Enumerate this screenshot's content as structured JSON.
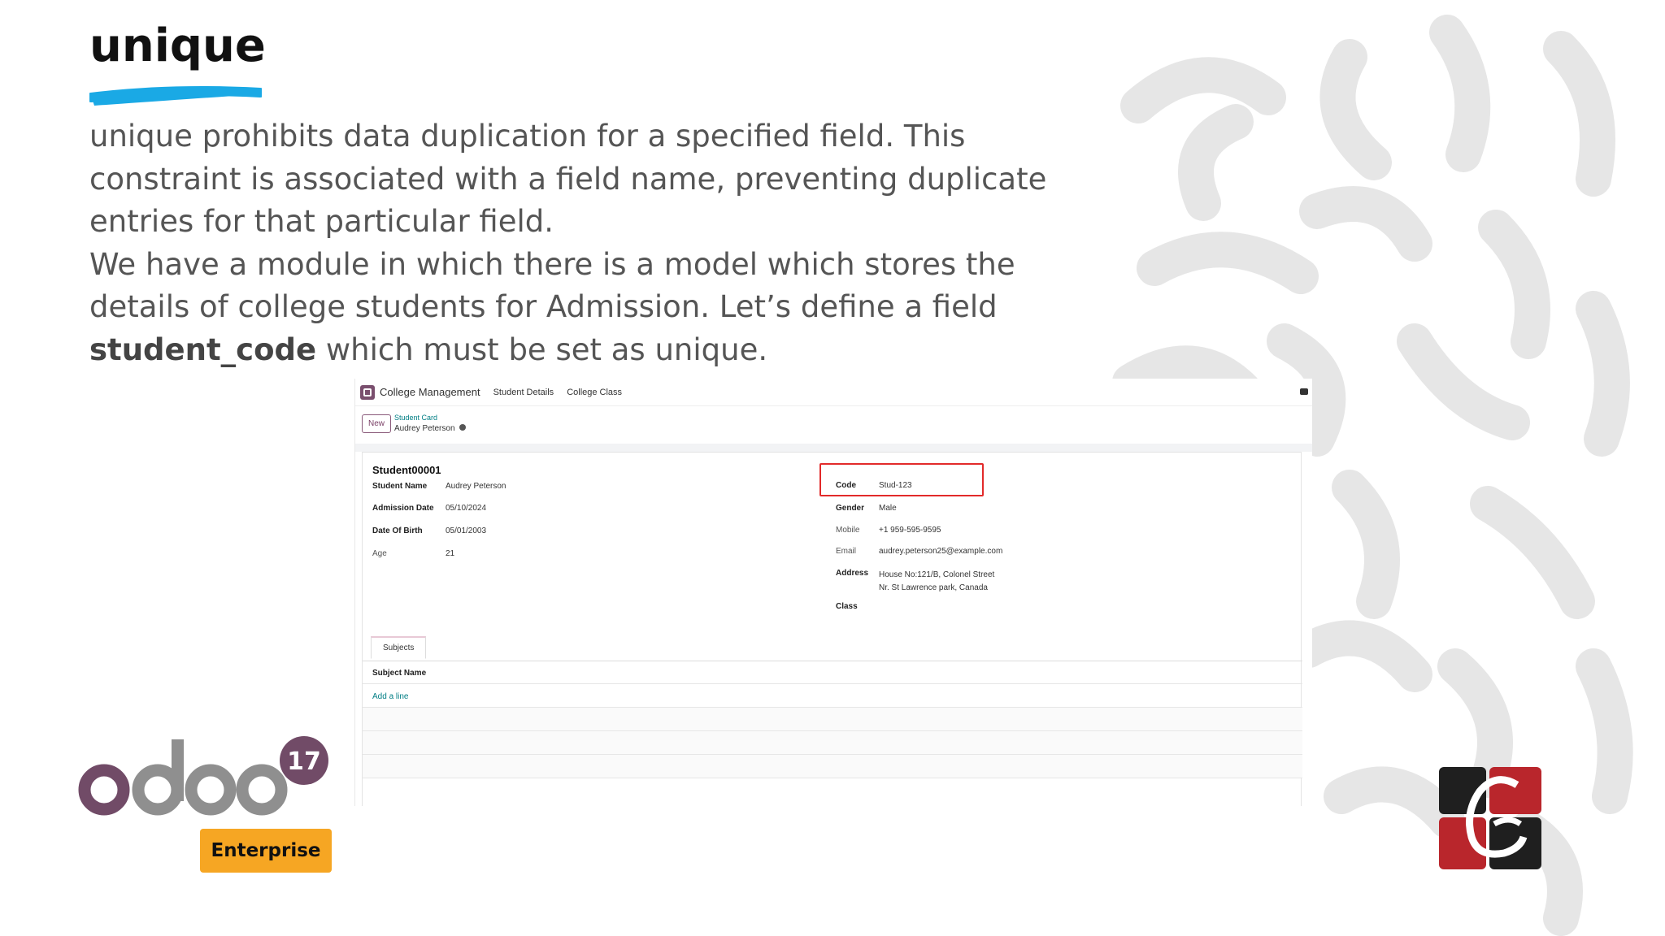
{
  "slide": {
    "title": "unique",
    "paragraph1": "unique prohibits data duplication for a specified field. This constraint is associated with a field name, preventing duplicate entries for that particular field.",
    "paragraph2_before": "We have a module in which there is a model which stores the details of college students for Admission. Let’s define a field ",
    "paragraph2_bold": "student_code",
    "paragraph2_after": " which must be set as unique."
  },
  "odoo": {
    "app_name": "College Management",
    "menu": [
      "Student Details",
      "College Class"
    ],
    "new_button": "New",
    "breadcrumb_parent": "Student Card",
    "breadcrumb_current": "Audrey Peterson",
    "record_title": "Student00001",
    "left_fields": [
      {
        "label": "Student Name",
        "value": "Audrey Peterson"
      },
      {
        "label": "Admission Date",
        "value": "05/10/2024"
      },
      {
        "label": "Date Of Birth",
        "value": "05/01/2003"
      },
      {
        "label": "Age",
        "value": "21"
      }
    ],
    "right_fields": [
      {
        "label": "Code",
        "value": "Stud-123"
      },
      {
        "label": "Gender",
        "value": "Male"
      },
      {
        "label": "Mobile",
        "value": "+1 959-595-9595"
      },
      {
        "label": "Email",
        "value": "audrey.peterson25@example.com"
      },
      {
        "label": "Address",
        "value_line1": "House No:121/B, Colonel Street",
        "value_line2": "Nr. St Lawrence park, Canada"
      },
      {
        "label": "Class",
        "value": ""
      }
    ],
    "tab_label": "Subjects",
    "subject_header": "Subject Name",
    "add_line": "Add a line",
    "highlight_color": "#e22a2a"
  },
  "branding": {
    "odoo_version": "17",
    "edition": "Enterprise",
    "colors": {
      "odoo_purple": "#714b67",
      "odoo_gray": "#8f8f8f",
      "enterprise": "#f6a623",
      "accent_blue": "#1aa9e5"
    }
  }
}
